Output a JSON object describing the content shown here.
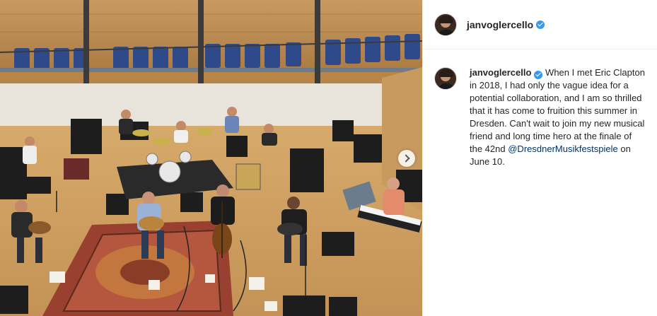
{
  "post": {
    "username": "janvoglercello",
    "verified": true,
    "caption_text": "When I met Eric Clapton in 2018, I had only the vague idea for a potential collaboration, and I am so thrilled that it has come to fruition this summer in Dresden. Can't wait to join my new musical friend and long time hero at the finale of the 42nd",
    "mention": "@DresdnerMusikfestspiele",
    "caption_tail": "on June 10."
  },
  "photo": {
    "next_icon": "chevron-right-icon"
  },
  "colors": {
    "link": "#003569",
    "verified": "#3897f0",
    "text": "#262626"
  }
}
